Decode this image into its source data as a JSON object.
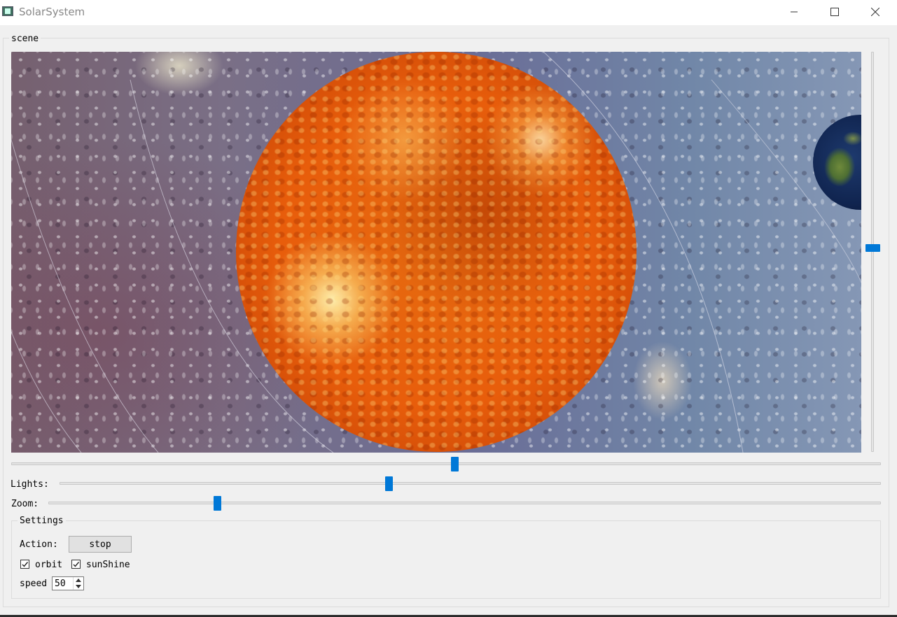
{
  "window": {
    "title": "SolarSystem"
  },
  "scene_group": {
    "title": "scene"
  },
  "sliders": {
    "vertical_level": 0.49,
    "horizontal_level": 0.51,
    "lights": {
      "label": "Lights:",
      "level": 0.4
    },
    "zoom": {
      "label": "Zoom:",
      "level": 0.2
    }
  },
  "settings": {
    "title": "Settings",
    "action_label": "Action:",
    "action_button": "stop",
    "orbit": {
      "label": "orbit",
      "checked": true
    },
    "sunshine": {
      "label": "sunShine",
      "checked": true
    },
    "speed_label": "speed",
    "speed_value": "50"
  },
  "colors": {
    "accent": "#0078d7",
    "background": "#f0f0f0"
  },
  "icons": [
    "app-icon",
    "minimize-icon",
    "maximize-icon",
    "close-icon",
    "checkmark-icon",
    "spin-up-icon",
    "spin-down-icon"
  ]
}
